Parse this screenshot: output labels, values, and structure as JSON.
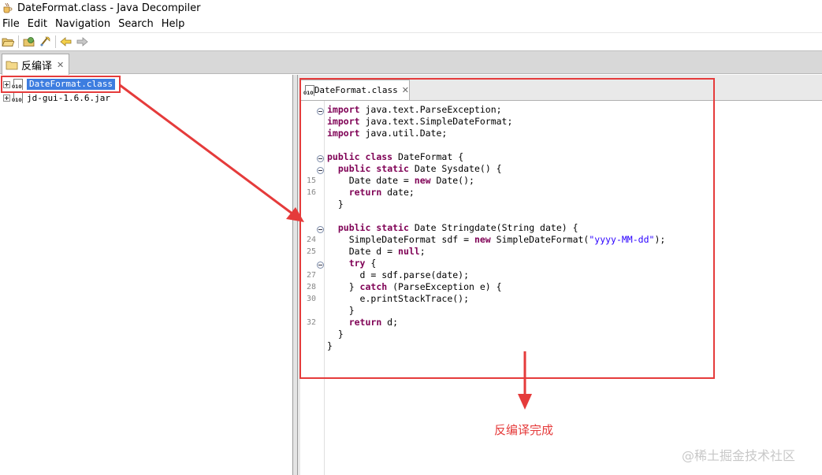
{
  "window": {
    "title": "DateFormat.class - Java Decompiler"
  },
  "menu": [
    "File",
    "Edit",
    "Navigation",
    "Search",
    "Help"
  ],
  "toolbar": {
    "icons": [
      "open-file-icon",
      "open-type-icon",
      "search-icon",
      "back-arrow-icon",
      "forward-arrow-icon"
    ]
  },
  "top_tab": {
    "label": "反编译",
    "icon": "folder-icon"
  },
  "tree": [
    {
      "label": "DateFormat.class",
      "selected": true,
      "icon": "class-file-icon"
    },
    {
      "label": "jd-gui-1.6.6.jar",
      "selected": false,
      "icon": "jar-file-icon"
    }
  ],
  "editor_tab": {
    "label": "DateFormat.class",
    "icon": "class-file-icon"
  },
  "line_numbers": [
    "15",
    "16",
    "24",
    "25",
    "27",
    "28",
    "30",
    "32"
  ],
  "code": [
    "import java.text.ParseException;",
    "import java.text.SimpleDateFormat;",
    "import java.util.Date;",
    "",
    "public class DateFormat {",
    "  public static Date Sysdate() {",
    "    Date date = new Date();",
    "    return date;",
    "  }",
    "",
    "  public static Date Stringdate(String date) {",
    "    SimpleDateFormat sdf = new SimpleDateFormat(\"yyyy-MM-dd\");",
    "    Date d = null;",
    "    try {",
    "      d = sdf.parse(date);",
    "    } catch (ParseException e) {",
    "      e.printStackTrace();",
    "    }",
    "    return d;",
    "  }",
    "}"
  ],
  "annotation": {
    "text": "反编译完成",
    "color": "#e53b3b"
  },
  "watermark": "@稀土掘金技术社区"
}
